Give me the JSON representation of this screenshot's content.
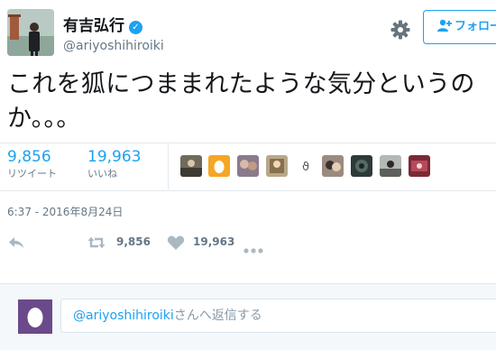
{
  "user": {
    "display_name": "有吉弘行",
    "handle": "@ariyoshihiroiki"
  },
  "follow_button": {
    "label": "フォロー"
  },
  "tweet": {
    "line1": "これを狐につままれたような気分というの",
    "line2": "か。。。"
  },
  "stats": {
    "retweets_count": "9,856",
    "retweets_label": "リツイート",
    "likes_count": "19,963",
    "likes_label": "いいね"
  },
  "timestamp": "6:37 - 2016年8月24日",
  "actions": {
    "retweet_count": "9,856",
    "like_count": "19,963"
  },
  "reply": {
    "mention": "@ariyoshihiroiki",
    "suffix": "さんへ返信する"
  },
  "colors": {
    "accent": "#1da1f2",
    "muted": "#657786",
    "border": "#e1e8ed",
    "reply_bg": "#f5f8fa"
  },
  "icons": [
    "verified-badge-icon",
    "gear-icon",
    "person-add-icon",
    "reply-icon",
    "retweet-icon",
    "heart-icon",
    "more-icon",
    "egg-icon"
  ]
}
